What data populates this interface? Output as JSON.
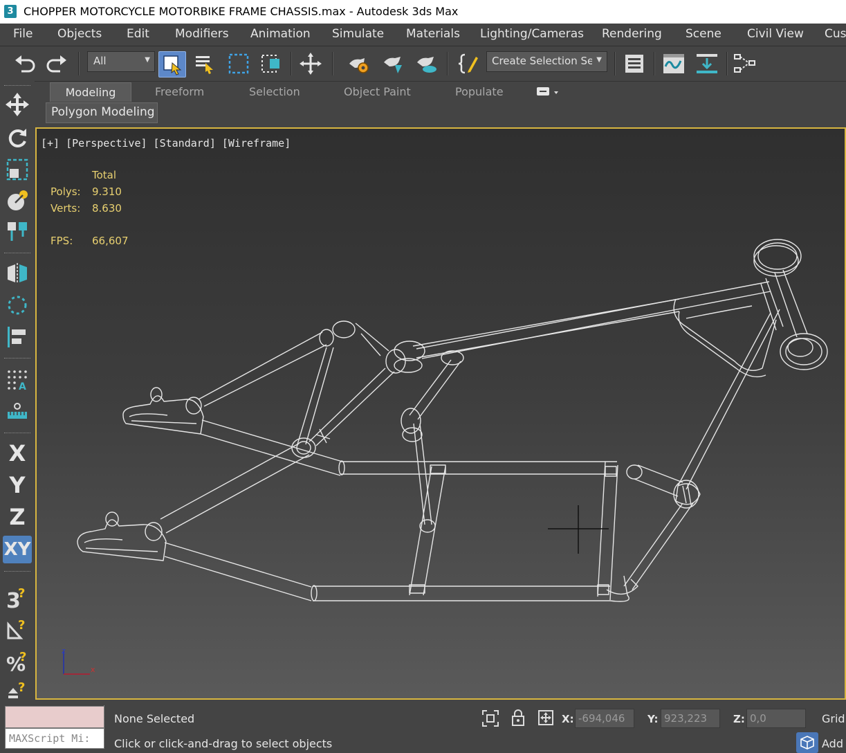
{
  "window": {
    "app_icon": "3",
    "title": "CHOPPER MOTORCYCLE MOTORBIKE FRAME CHASSIS.max - Autodesk 3ds Max"
  },
  "menu": [
    "File",
    "Objects",
    "Edit",
    "Modifiers",
    "Animation",
    "Simulate",
    "Materials",
    "Lighting/Cameras",
    "Rendering",
    "Scene",
    "Civil View",
    "Cus"
  ],
  "toolbar": {
    "selection_filter": "All",
    "create_selection_set": "Create Selection Se",
    "icons": [
      "undo-icon",
      "redo-icon",
      "select-object-icon",
      "select-by-name-icon",
      "rectangular-selection-icon",
      "window-crossing-icon",
      "move-icon",
      "render-setup-icon",
      "render-frame-icon",
      "render-icon",
      "edit-named-selection-icon",
      "layer-explorer-icon",
      "curve-editor-icon",
      "schematic-view-icon",
      "track-view-icon"
    ]
  },
  "ribbon": {
    "tabs": [
      "Modeling",
      "Freeform",
      "Selection",
      "Object Paint",
      "Populate"
    ],
    "active_tab": "Modeling",
    "panel": "Polygon Modeling"
  },
  "left_bar": {
    "axis_labels": [
      "X",
      "Y",
      "Z",
      "XY"
    ],
    "active_axis": "XY"
  },
  "viewport": {
    "label": "[+] [Perspective] [Standard] [Wireframe]",
    "stats_header": "Total",
    "polys_label": "Polys:",
    "polys": "9.310",
    "verts_label": "Verts:",
    "verts": "8.630",
    "fps_label": "FPS:",
    "fps": "66,607",
    "axis_tripod": {
      "z": "z",
      "x": "x"
    },
    "border_color": "#d8b640",
    "wire_color": "#e8e8e8"
  },
  "status": {
    "maxscript": "MAXScript Mi:",
    "selection": "None Selected",
    "prompt": "Click or click-and-drag to select objects",
    "x_label": "X:",
    "x": "-694,046",
    "y_label": "Y:",
    "y": "923,223",
    "z_label": "Z:",
    "z": "0,0",
    "grid": "Grid",
    "add": "Add"
  }
}
